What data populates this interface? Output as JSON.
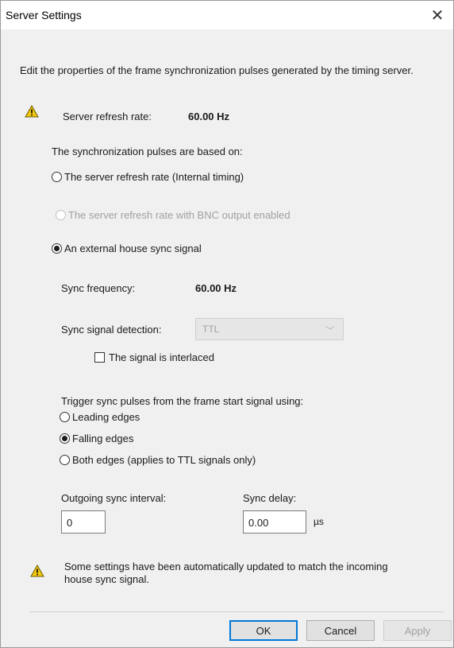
{
  "window": {
    "title": "Server Settings",
    "close_glyph": "✕"
  },
  "description": "Edit the properties of the frame synchronization pulses generated by the timing server.",
  "refresh": {
    "label": "Server refresh rate:",
    "value": "60.00 Hz",
    "icon": "warning-icon"
  },
  "pulses_label": "The synchronization pulses are based on:",
  "pulse_options": {
    "internal": "The server refresh rate (Internal timing)",
    "bnc": "The server refresh rate with BNC output enabled",
    "external": "An external house sync signal"
  },
  "pulse_selected": "external",
  "sync_frequency": {
    "label": "Sync frequency:",
    "value": "60.00 Hz"
  },
  "sync_detection": {
    "label": "Sync signal detection:",
    "value": "TTL"
  },
  "interlaced": {
    "label": "The signal is interlaced",
    "checked": false
  },
  "trigger": {
    "label": "Trigger sync pulses from the frame start signal using:",
    "leading": "Leading edges",
    "falling": "Falling edges",
    "both": "Both edges (applies to TTL signals only)",
    "selected": "falling"
  },
  "outgoing_interval": {
    "label": "Outgoing sync interval:",
    "value": "0"
  },
  "sync_delay": {
    "label": "Sync delay:",
    "value": "0.00",
    "unit": "µs"
  },
  "notice": {
    "text": "Some settings have been automatically updated to match the incoming house sync signal.",
    "icon": "warning-icon"
  },
  "buttons": {
    "ok": "OK",
    "cancel": "Cancel",
    "apply": "Apply"
  },
  "colors": {
    "warning_fill": "#f2c811",
    "default_button_border": "#0078d7"
  }
}
